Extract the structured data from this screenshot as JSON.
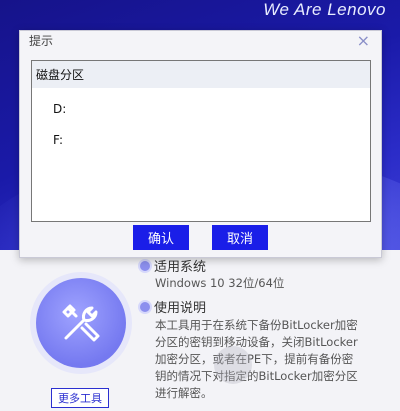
{
  "banner": {
    "slogan": "We Are Lenovo"
  },
  "dialog": {
    "title": "提示",
    "close_glyph": "×",
    "list_header": "磁盘分区",
    "items": [
      "D:",
      "F:"
    ],
    "confirm_label": "确认",
    "cancel_label": "取消"
  },
  "info": {
    "system_title": "适用系统",
    "system_value": "Windows 10 32位/64位",
    "usage_title": "使用说明",
    "usage_lines": [
      "本工具用于在系统下备份BitLocker加密",
      "分区的密钥到移动设备，关闭BitLocker",
      "加密分区，或者在PE下，提前有备份密",
      "钥的情况下对指定的BitLocker加密分区",
      "进行解密。"
    ],
    "more_tools_label": "更多工具"
  },
  "colors": {
    "accent": "#1a1ee8",
    "banner": "#1a1aa8",
    "icon_circle": "#7579f0"
  }
}
